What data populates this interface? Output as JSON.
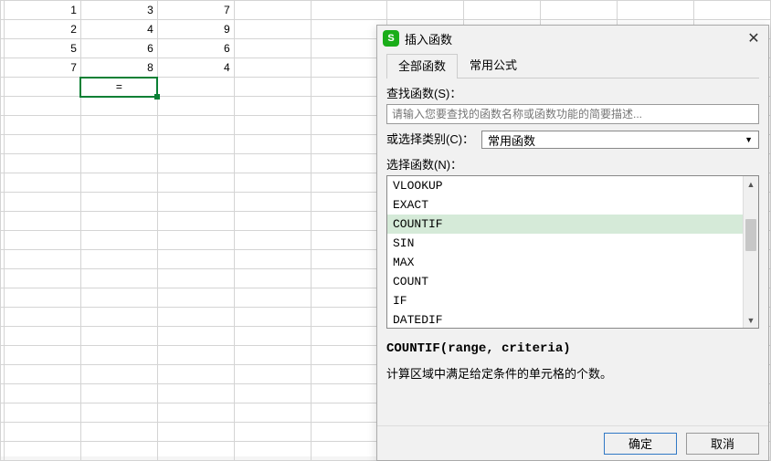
{
  "spreadsheet": {
    "activeCell": "=",
    "rows": [
      [
        "1",
        "3",
        "7"
      ],
      [
        "2",
        "4",
        "9"
      ],
      [
        "5",
        "6",
        "6"
      ],
      [
        "7",
        "8",
        "4"
      ]
    ]
  },
  "dialog": {
    "title": "插入函数",
    "appIconLetter": "S",
    "tabs": {
      "all": "全部函数",
      "common": "常用公式"
    },
    "search": {
      "label": "查找函数(S)：",
      "placeholder": "请输入您要查找的函数名称或函数功能的简要描述..."
    },
    "category": {
      "label": "或选择类别(C)：",
      "selected": "常用函数"
    },
    "selectFunctionLabel": "选择函数(N)：",
    "functions": [
      "VLOOKUP",
      "EXACT",
      "COUNTIF",
      "SIN",
      "MAX",
      "COUNT",
      "IF",
      "DATEDIF"
    ],
    "selectedFunction": "COUNTIF",
    "syntax": "COUNTIF(range, criteria)",
    "description": "计算区域中满足给定条件的单元格的个数。",
    "buttons": {
      "ok": "确定",
      "cancel": "取消"
    }
  }
}
